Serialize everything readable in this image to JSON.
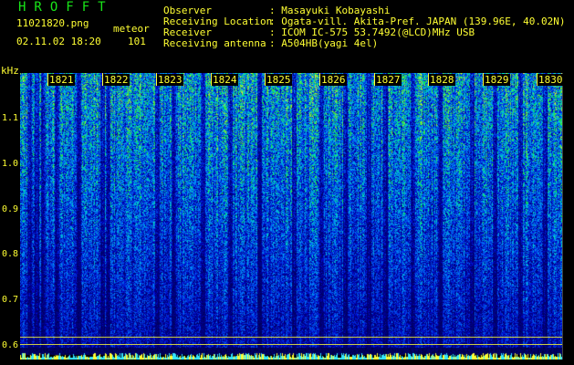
{
  "brand": "HROFFT",
  "file_name": "11021820.png",
  "datetime": "02.11.02 18:20",
  "mode": "meteor",
  "count": "101",
  "header": [
    {
      "key": "Observer",
      "value": ": Masayuki Kobayashi"
    },
    {
      "key": "Receiving Location",
      "value": ": Ogata-vill. Akita-Pref. JAPAN (139.96E, 40.02N)"
    },
    {
      "key": "Receiver",
      "value": ": ICOM IC-575 53.7492(@LCD)MHz USB"
    },
    {
      "key": "Receiving antenna",
      "value": ": A504HB(yagi 4el)"
    }
  ],
  "y_unit": "kHz",
  "y_labels": [
    "1.1",
    "1.0",
    "0.9",
    "0.8",
    "0.7",
    "0.6"
  ],
  "x_minutes": [
    "1821",
    "1822",
    "1823",
    "1824",
    "1825",
    "1826",
    "1827",
    "1828",
    "1829",
    "1830"
  ],
  "colors": {
    "label": "#ffff33",
    "brand": "#19e619",
    "background": "#000000"
  }
}
